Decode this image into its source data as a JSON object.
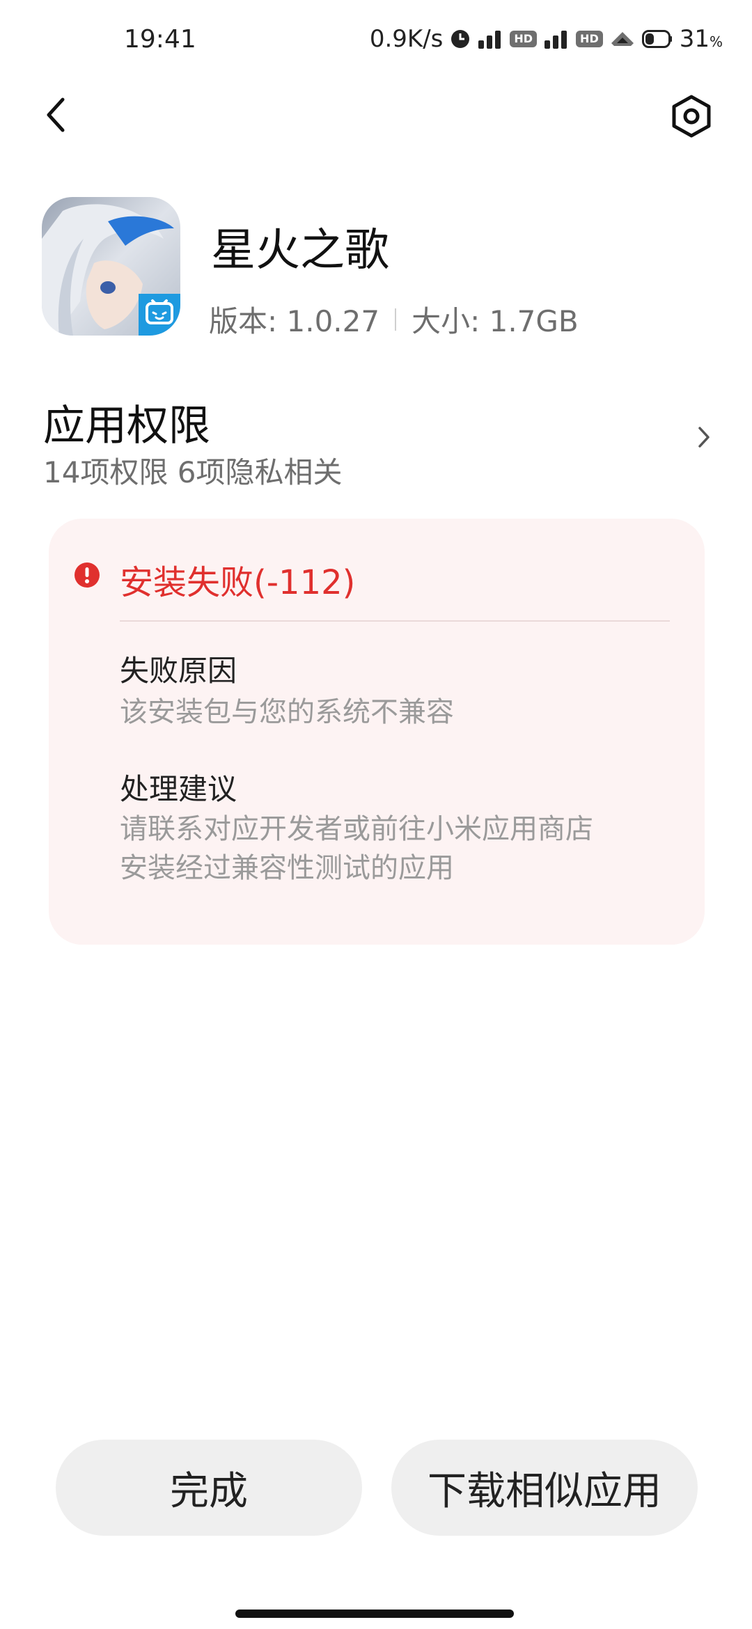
{
  "status_bar": {
    "time": "19:41",
    "net_speed": "0.9K/s",
    "hd1": "HD",
    "hd2": "HD",
    "battery": "31",
    "battery_unit": "%"
  },
  "nav": {
    "back_icon": "chevron-left-icon",
    "settings_icon": "settings-hexagon-icon"
  },
  "app": {
    "name": "星火之歌",
    "version": "版本: 1.0.27",
    "size": "大小: 1.7GB"
  },
  "permissions": {
    "title": "应用权限",
    "summary": "14项权限 6项隐私相关"
  },
  "error": {
    "title": "安装失败(-112)",
    "reason_label": "失败原因",
    "reason_text": "该安装包与您的系统不兼容",
    "advice_label": "处理建议",
    "advice_line1": "请联系对应开发者或前往小米应用商店",
    "advice_line2": "安装经过兼容性测试的应用",
    "accent_color": "#e0302e"
  },
  "buttons": {
    "done": "完成",
    "download_similar": "下载相似应用"
  }
}
